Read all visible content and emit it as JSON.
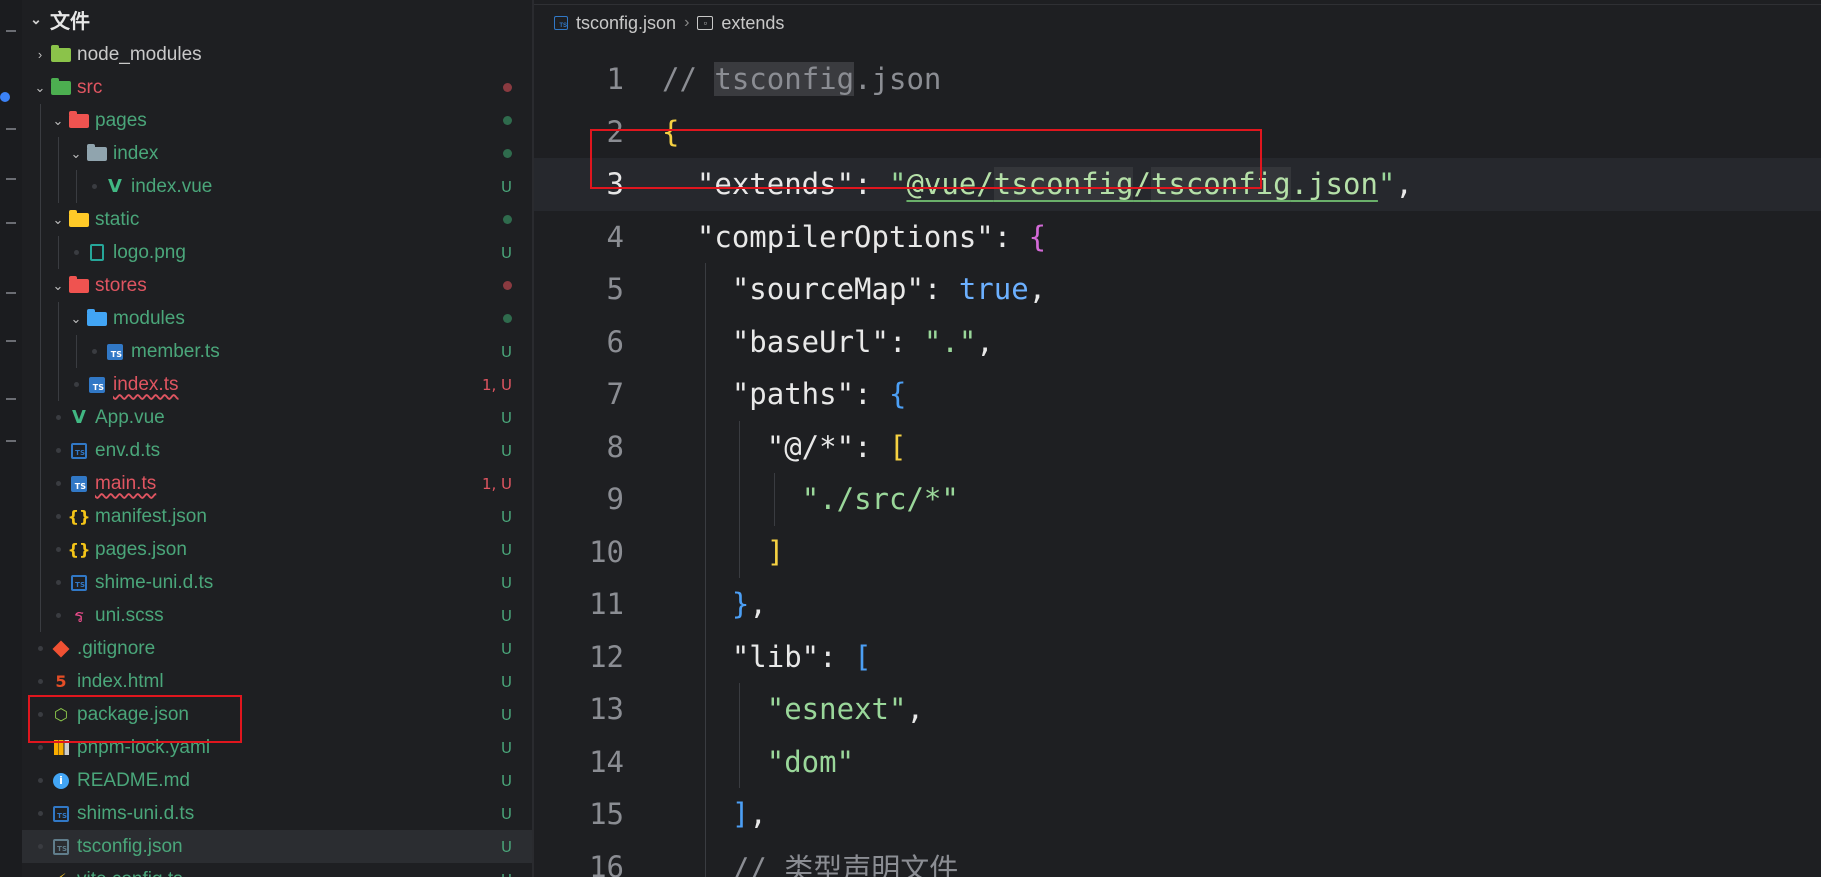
{
  "explorer": {
    "title": "文件",
    "items": [
      {
        "name": "node_modules",
        "kind": "folder-node",
        "depth": 0,
        "chevron": "right",
        "color": "gray",
        "badge": ""
      },
      {
        "name": "src",
        "kind": "folder-src",
        "depth": 0,
        "chevron": "down",
        "color": "red",
        "badge": "dot-red"
      },
      {
        "name": "pages",
        "kind": "folder-pages",
        "depth": 1,
        "chevron": "down",
        "color": "green",
        "badge": "dot-green"
      },
      {
        "name": "index",
        "kind": "folder-open",
        "depth": 2,
        "chevron": "down",
        "color": "green",
        "badge": "dot-green"
      },
      {
        "name": "index.vue",
        "kind": "vue",
        "depth": 3,
        "chevron": "none",
        "color": "green",
        "badge": "U"
      },
      {
        "name": "static",
        "kind": "folder-static",
        "depth": 1,
        "chevron": "down",
        "color": "green",
        "badge": "dot-green"
      },
      {
        "name": "logo.png",
        "kind": "image",
        "depth": 2,
        "chevron": "none",
        "color": "green",
        "badge": "U"
      },
      {
        "name": "stores",
        "kind": "folder-stores",
        "depth": 1,
        "chevron": "down",
        "color": "red",
        "badge": "dot-red"
      },
      {
        "name": "modules",
        "kind": "folder-modules",
        "depth": 2,
        "chevron": "down",
        "color": "green",
        "badge": "dot-green"
      },
      {
        "name": "member.ts",
        "kind": "ts",
        "depth": 3,
        "chevron": "none",
        "color": "green",
        "badge": "U"
      },
      {
        "name": "index.ts",
        "kind": "ts",
        "depth": 2,
        "chevron": "none",
        "color": "red-squiggle",
        "badge": "1, U"
      },
      {
        "name": "App.vue",
        "kind": "vue",
        "depth": 1,
        "chevron": "none",
        "color": "green",
        "badge": "U"
      },
      {
        "name": "env.d.ts",
        "kind": "ts-outline",
        "depth": 1,
        "chevron": "none",
        "color": "green",
        "badge": "U"
      },
      {
        "name": "main.ts",
        "kind": "ts",
        "depth": 1,
        "chevron": "none",
        "color": "red-squiggle",
        "badge": "1, U"
      },
      {
        "name": "manifest.json",
        "kind": "json",
        "depth": 1,
        "chevron": "none",
        "color": "green",
        "badge": "U"
      },
      {
        "name": "pages.json",
        "kind": "json",
        "depth": 1,
        "chevron": "none",
        "color": "green",
        "badge": "U"
      },
      {
        "name": "shime-uni.d.ts",
        "kind": "ts-outline",
        "depth": 1,
        "chevron": "none",
        "color": "green",
        "badge": "U"
      },
      {
        "name": "uni.scss",
        "kind": "scss",
        "depth": 1,
        "chevron": "none",
        "color": "green",
        "badge": "U"
      },
      {
        "name": ".gitignore",
        "kind": "git",
        "depth": 0,
        "chevron": "none",
        "color": "green",
        "badge": "U"
      },
      {
        "name": "index.html",
        "kind": "html",
        "depth": 0,
        "chevron": "none",
        "color": "green",
        "badge": "U"
      },
      {
        "name": "package.json",
        "kind": "node",
        "depth": 0,
        "chevron": "none",
        "color": "green",
        "badge": "U"
      },
      {
        "name": "pnpm-lock.yaml",
        "kind": "pnpm",
        "depth": 0,
        "chevron": "none",
        "color": "green",
        "badge": "U"
      },
      {
        "name": "README.md",
        "kind": "info",
        "depth": 0,
        "chevron": "none",
        "color": "green",
        "badge": "U"
      },
      {
        "name": "shims-uni.d.ts",
        "kind": "ts-outline",
        "depth": 0,
        "chevron": "none",
        "color": "green",
        "badge": "U"
      },
      {
        "name": "tsconfig.json",
        "kind": "tsconfig",
        "depth": 0,
        "chevron": "none",
        "color": "green",
        "badge": "U",
        "selected": true
      },
      {
        "name": "vite.config.ts",
        "kind": "vite",
        "depth": 0,
        "chevron": "none",
        "color": "green",
        "badge": "U"
      }
    ]
  },
  "breadcrumb": {
    "file": "tsconfig.json",
    "symbol": "extends"
  },
  "editor": {
    "current_line": 3,
    "lines": [
      {
        "n": "1",
        "indent": 0
      },
      {
        "n": "2",
        "indent": 0
      },
      {
        "n": "3",
        "indent": 1
      },
      {
        "n": "4",
        "indent": 1
      },
      {
        "n": "5",
        "indent": 2
      },
      {
        "n": "6",
        "indent": 2
      },
      {
        "n": "7",
        "indent": 2
      },
      {
        "n": "8",
        "indent": 3
      },
      {
        "n": "9",
        "indent": 4
      },
      {
        "n": "10",
        "indent": 3
      },
      {
        "n": "11",
        "indent": 2
      },
      {
        "n": "12",
        "indent": 2
      },
      {
        "n": "13",
        "indent": 3
      },
      {
        "n": "14",
        "indent": 3
      },
      {
        "n": "15",
        "indent": 2
      },
      {
        "n": "16",
        "indent": 2
      }
    ],
    "code": {
      "l1_comment": "// ",
      "l1_word": "tsconfig",
      "l1_rest": ".json",
      "l2": "{",
      "l3_key": "\"extends\"",
      "l3_colon": ": ",
      "l3_q1": "\"",
      "l3_p1": "@vue/",
      "l3_p2": "tsconfig",
      "l3_p3": "/",
      "l3_p4": "tsconfig",
      "l3_p5": ".json",
      "l3_q2": "\"",
      "l3_comma": ",",
      "l4_key": "\"compilerOptions\"",
      "l4_colon": ": ",
      "l4_brace": "{",
      "l5_key": "\"sourceMap\"",
      "l5_colon": ": ",
      "l5_val": "true",
      "l5_comma": ",",
      "l6_key": "\"baseUrl\"",
      "l6_colon": ": ",
      "l6_val": "\".\"",
      "l6_comma": ",",
      "l7_key": "\"paths\"",
      "l7_colon": ": ",
      "l7_brace": "{",
      "l8_key": "\"@/*\"",
      "l8_colon": ": ",
      "l8_bracket": "[",
      "l9_val": "\"./src/*\"",
      "l10_bracket": "]",
      "l11_brace": "}",
      "l11_comma": ",",
      "l12_key": "\"lib\"",
      "l12_colon": ": ",
      "l12_bracket": "[",
      "l13_val": "\"esnext\"",
      "l13_comma": ",",
      "l14_val": "\"dom\"",
      "l15_bracket": "]",
      "l15_comma": ",",
      "l16_comment": "// 类型声明文件"
    }
  },
  "colors": {
    "git_added": "#4aa67a",
    "git_error": "#e05561",
    "annotation_box": "#e0161e"
  }
}
